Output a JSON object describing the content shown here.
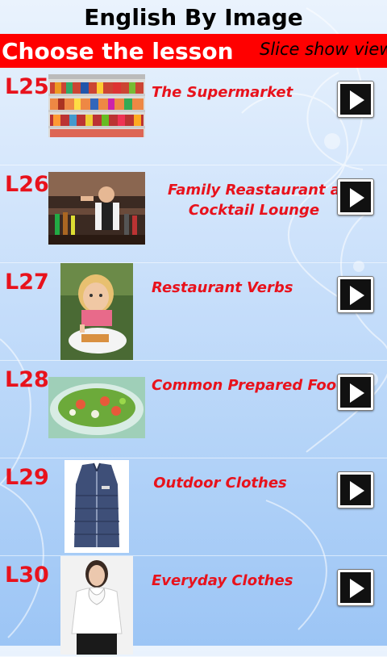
{
  "app": {
    "title": "English By Image"
  },
  "header": {
    "choose_label": "Choose the lesson",
    "slideshow_label": "Slice show view"
  },
  "lessons": [
    {
      "code": "L25",
      "title_lines": [
        "The Supermarket",
        ""
      ],
      "thumbnail": "supermarket-shelves-photo"
    },
    {
      "code": "L26",
      "title_lines": [
        "Family Reastaurant a",
        "Cocktail Lounge"
      ],
      "thumbnail": "bartender-photo"
    },
    {
      "code": "L27",
      "title_lines": [
        "Restaurant Verbs",
        ""
      ],
      "thumbnail": "child-eating-photo"
    },
    {
      "code": "L28",
      "title_lines": [
        "Common Prepared Food",
        ""
      ],
      "thumbnail": "salad-bowl-photo"
    },
    {
      "code": "L29",
      "title_lines": [
        "Outdoor Clothes",
        ""
      ],
      "thumbnail": "puffer-vest-photo"
    },
    {
      "code": "L30",
      "title_lines": [
        "Everyday Clothes",
        ""
      ],
      "thumbnail": "woman-blouse-photo"
    }
  ],
  "icons": {
    "play": "play-icon"
  },
  "colors": {
    "accent_red": "#ff0000",
    "lesson_text": "#e8121c"
  }
}
